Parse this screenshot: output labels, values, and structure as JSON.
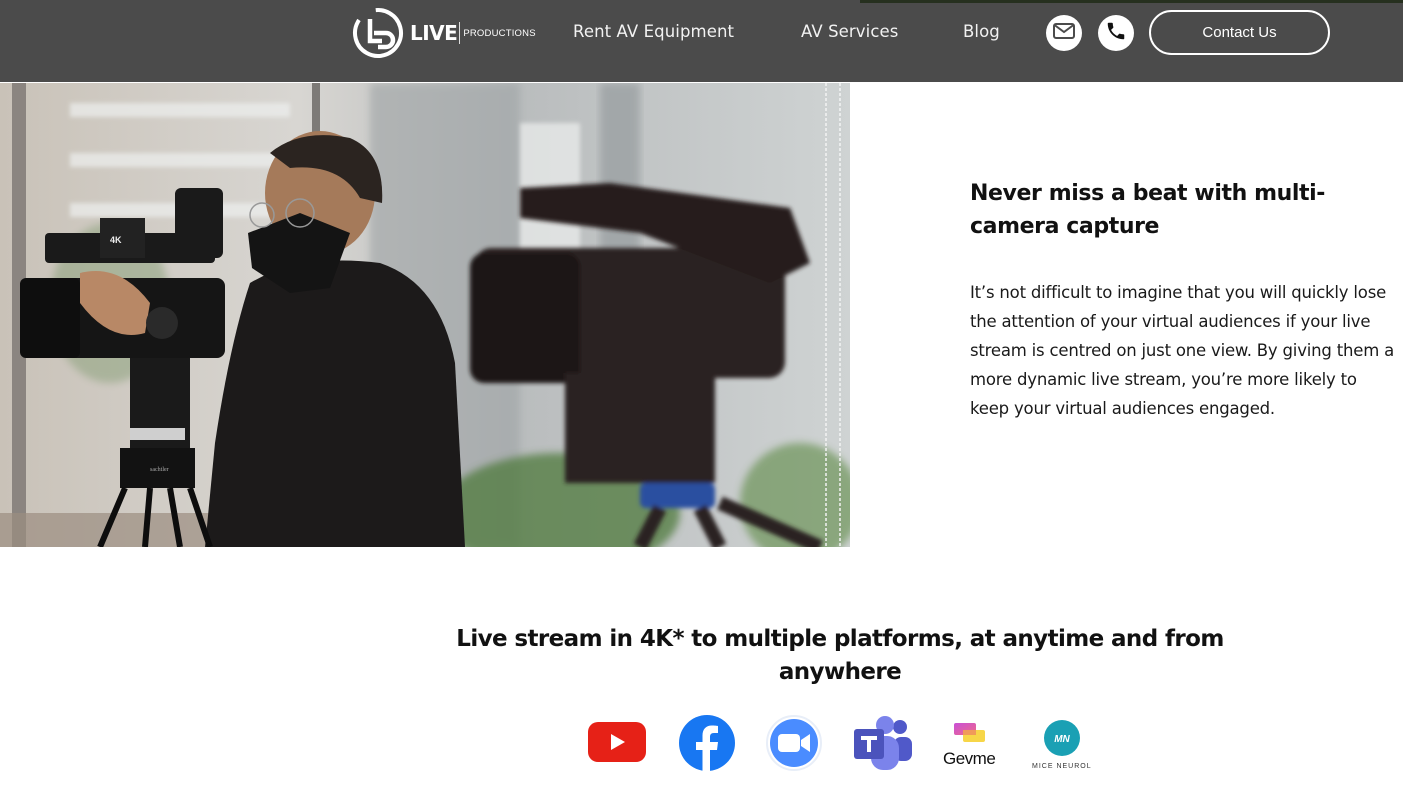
{
  "header": {
    "logo": {
      "wordmark": "LIVE",
      "subtitle": "PRODUCTIONS",
      "icon": "live-productions-logo-icon"
    },
    "nav": [
      {
        "label": "Rent AV Equipment"
      },
      {
        "label": "AV Services"
      },
      {
        "label": "Blog"
      }
    ],
    "icons": {
      "email": "envelope-icon",
      "phone": "phone-icon"
    },
    "contact_label": "Contact Us",
    "bg_color": "#4b4b4b"
  },
  "hero": {
    "image_alt": "Cameraman in black mask operating a 4K video camera on a Sachtler tripod, with a second out-of-focus camera in the foreground",
    "camera_badge": "4K",
    "tripod_brand": "sachtler"
  },
  "feature": {
    "title": "Never miss a beat with multi-camera capture",
    "body": "It’s not difficult to imagine that you will quickly lose the attention of your virtual audiences if your live stream is centred on just one view. By giving them a more dynamic live stream, you’re more likely to keep your virtual audiences engaged."
  },
  "streaming": {
    "title": "Live stream in 4K* to multiple platforms, at anytime and from anywhere",
    "platforms": [
      {
        "name": "YouTube",
        "icon": "youtube-icon",
        "color": "#e62117"
      },
      {
        "name": "Facebook",
        "icon": "facebook-icon",
        "color": "#1877f2"
      },
      {
        "name": "Zoom",
        "icon": "zoom-icon",
        "color": "#4a8cff"
      },
      {
        "name": "Microsoft Teams",
        "icon": "teams-icon",
        "color": "#5059c9"
      },
      {
        "name": "Gevme",
        "icon": "gevme-icon",
        "label": "Gevme"
      },
      {
        "name": "Mice Neurol",
        "icon": "mice-neurol-icon",
        "badge": "MN",
        "label": "MICE NEUROL",
        "color": "#1aa0b4"
      }
    ]
  }
}
